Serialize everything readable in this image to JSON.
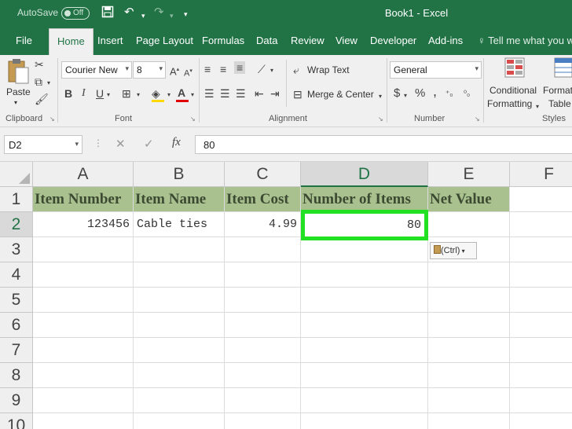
{
  "titlebar": {
    "autosave_label": "AutoSave",
    "autosave_state": "Off",
    "title": "Book1  -  Excel"
  },
  "tabs": [
    {
      "label": "File"
    },
    {
      "label": "Home"
    },
    {
      "label": "Insert"
    },
    {
      "label": "Page Layout"
    },
    {
      "label": "Formulas"
    },
    {
      "label": "Data"
    },
    {
      "label": "Review"
    },
    {
      "label": "View"
    },
    {
      "label": "Developer"
    },
    {
      "label": "Add-ins"
    }
  ],
  "tell_me": "Tell me what you wa",
  "ribbon": {
    "clipboard": {
      "paste": "Paste",
      "label": "Clipboard"
    },
    "font": {
      "name": "Courier New",
      "size": "8",
      "label": "Font",
      "bold": "B",
      "italic": "I",
      "underline": "U"
    },
    "alignment": {
      "wrap": "Wrap Text",
      "merge": "Merge & Center",
      "label": "Alignment"
    },
    "number": {
      "format": "General",
      "currency": "$",
      "percent": "%",
      "comma": ",",
      "label": "Number"
    },
    "styles": {
      "conditional_1": "Conditional",
      "conditional_2": "Formatting",
      "format_1": "Format",
      "format_2": "Table",
      "label": "Styles"
    }
  },
  "formula_bar": {
    "name_box": "D2",
    "fx": "fx",
    "value": "80"
  },
  "columns": [
    "A",
    "B",
    "C",
    "D",
    "E",
    "F"
  ],
  "rows": [
    "1",
    "2",
    "3",
    "4",
    "5",
    "6",
    "7",
    "8",
    "9",
    "10"
  ],
  "row1": {
    "a": "Item Number",
    "b": "Item Name",
    "c": "Item Cost",
    "d": "Number of Items",
    "e": "Net Value"
  },
  "row2": {
    "a": "123456",
    "b": "Cable ties",
    "c": "4.99",
    "d": "80"
  },
  "paste_options": "(Ctrl)",
  "colors": {
    "excel_green": "#217346",
    "header_fill": "#a9c18f",
    "selection_highlight": "#22e022"
  }
}
